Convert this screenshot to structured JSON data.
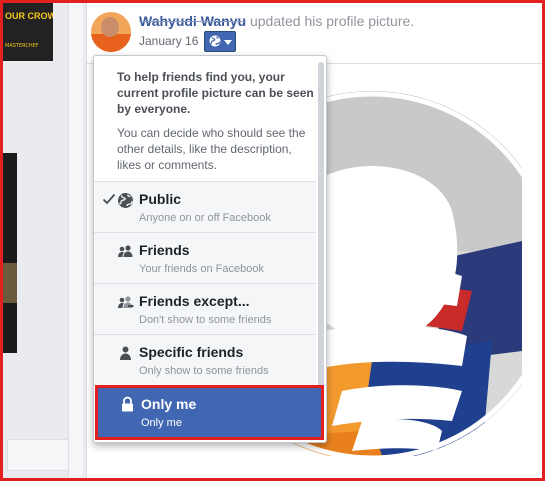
{
  "left_ad": {
    "text": "OUR CROWN",
    "small": "MASTERCHEF"
  },
  "post": {
    "author": "Wahyudi Wanyu",
    "action": "updated his profile picture.",
    "date": "January 16",
    "audience_icon": "globe-icon"
  },
  "privacy_menu": {
    "heading": "To help friends find you, your current profile picture can be seen by everyone.",
    "body": "You can decide who should see the other details, like the description, likes or comments.",
    "options": [
      {
        "title": "Public",
        "desc": "Anyone on or off Facebook",
        "icon": "globe-icon",
        "checked": true
      },
      {
        "title": "Friends",
        "desc": "Your friends on Facebook",
        "icon": "friends-icon"
      },
      {
        "title": "Friends except...",
        "desc": "Don't show to some friends",
        "icon": "friends-except-icon"
      },
      {
        "title": "Specific friends",
        "desc": "Only show to some friends",
        "icon": "specific-friend-icon"
      },
      {
        "title": "Only me",
        "desc": "Only me",
        "icon": "lock-icon",
        "highlighted": true
      }
    ]
  },
  "colors": {
    "accent": "#4267b2",
    "highlight_border": "#e41f1f"
  }
}
